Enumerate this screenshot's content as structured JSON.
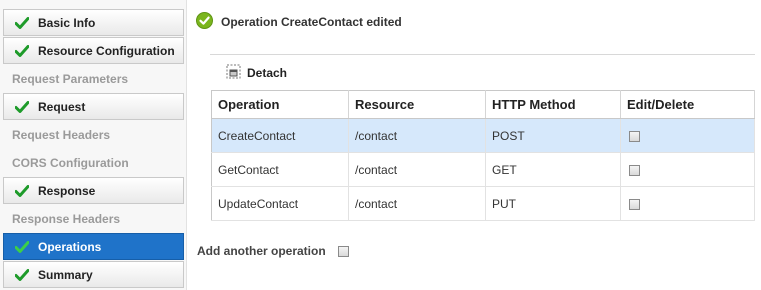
{
  "nav": {
    "items": [
      {
        "label": "Basic Info",
        "state": "done"
      },
      {
        "label": "Resource Configuration",
        "state": "done"
      },
      {
        "label": "Request Parameters",
        "state": "disabled"
      },
      {
        "label": "Request",
        "state": "done"
      },
      {
        "label": "Request Headers",
        "state": "disabled"
      },
      {
        "label": "CORS Configuration",
        "state": "disabled"
      },
      {
        "label": "Response",
        "state": "done"
      },
      {
        "label": "Response Headers",
        "state": "disabled"
      },
      {
        "label": "Operations",
        "state": "active"
      },
      {
        "label": "Summary",
        "state": "done"
      }
    ]
  },
  "message": {
    "text": "Operation CreateContact edited",
    "icon": "success-check-icon"
  },
  "toolbar": {
    "detach_label": "Detach"
  },
  "table": {
    "headers": [
      "Operation",
      "Resource",
      "HTTP Method",
      "Edit/Delete"
    ],
    "rows": [
      {
        "operation": "CreateContact",
        "resource": "/contact",
        "method": "POST",
        "checked": false
      },
      {
        "operation": "GetContact",
        "resource": "/contact",
        "method": "GET",
        "checked": false
      },
      {
        "operation": "UpdateContact",
        "resource": "/contact",
        "method": "PUT",
        "checked": false
      }
    ],
    "selected_row": 0
  },
  "add_operation": {
    "label": "Add another operation",
    "checked": false
  },
  "colors": {
    "active": "#1f73c9",
    "check": "#1e9b2a",
    "selected_row": "#d6e8fb",
    "success": "#7ab51d"
  }
}
